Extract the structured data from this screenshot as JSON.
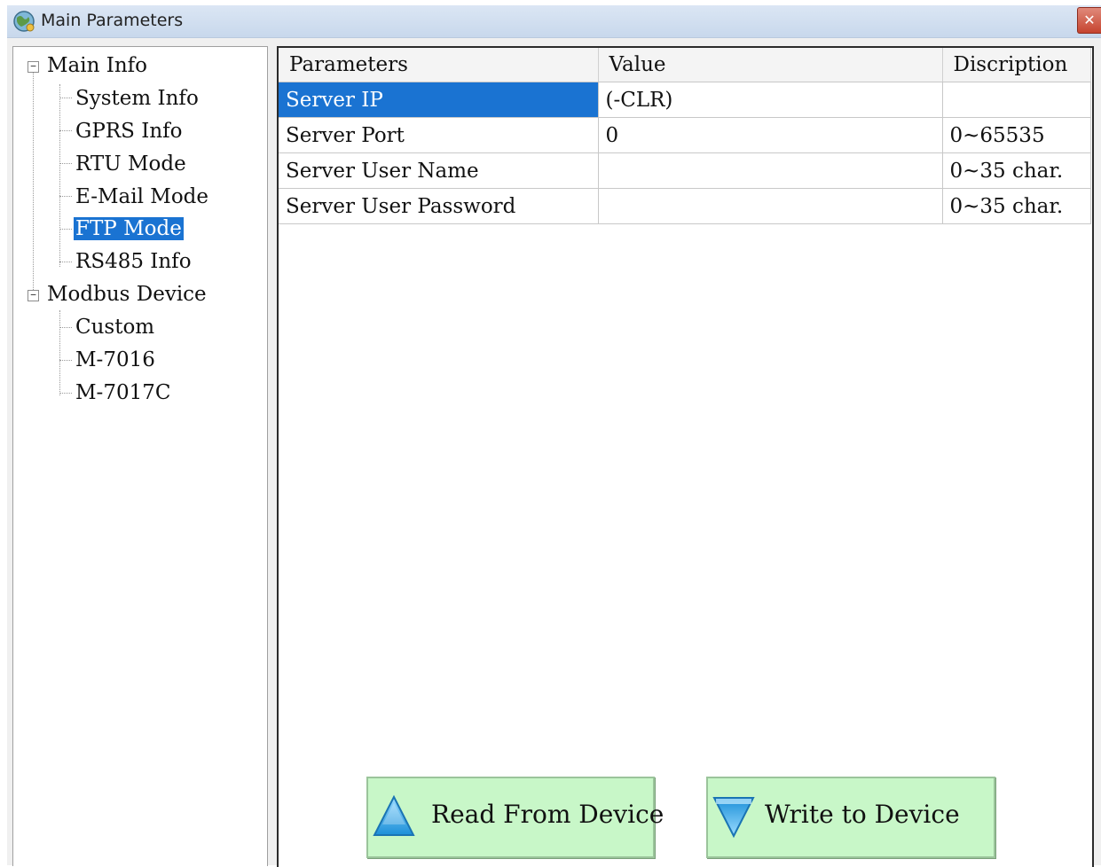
{
  "window": {
    "title": "Main Parameters",
    "close_glyph": "✕"
  },
  "tree": {
    "groups": [
      {
        "label": "Main Info",
        "expander": "−",
        "children": [
          "System Info",
          "GPRS Info",
          "RTU Mode",
          "E-Mail Mode",
          "FTP Mode",
          "RS485 Info"
        ]
      },
      {
        "label": "Modbus Device",
        "expander": "−",
        "children": [
          "Custom",
          "M-7016",
          "M-7017C"
        ]
      }
    ],
    "selected": "FTP Mode"
  },
  "grid": {
    "headers": [
      "Parameters",
      "Value",
      "Discription"
    ],
    "rows": [
      [
        "Server IP",
        "(-CLR)",
        ""
      ],
      [
        "Server Port",
        "0",
        "0~65535"
      ],
      [
        "Server User Name",
        "",
        "0~35 char."
      ],
      [
        "Server User Password",
        "",
        "0~35 char."
      ]
    ],
    "selected_row": 0
  },
  "buttons": {
    "read": {
      "label": "Read From Device",
      "icon": "up-triangle-icon"
    },
    "write": {
      "label": "Write to Device",
      "icon": "down-triangle-icon"
    }
  },
  "colors": {
    "selection": "#1a73d2",
    "button_bg": "#c8f7c8",
    "icon_blue": "#3aa9e8"
  }
}
